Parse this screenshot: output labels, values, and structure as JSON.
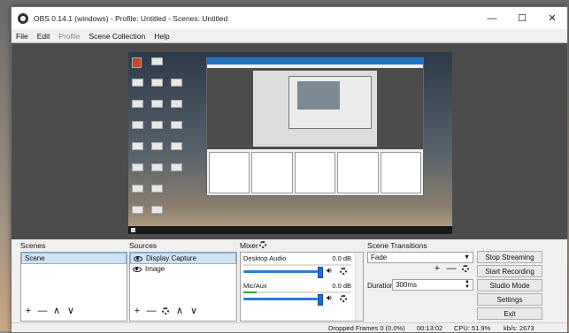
{
  "window": {
    "title": "OBS 0.14.1 (windows) - Profile: Untitled - Scenes: Untitled",
    "minimize_glyph": "—",
    "maximize_glyph": "☐",
    "close_glyph": "✕"
  },
  "menu": [
    "File",
    "Edit",
    "Profile",
    "Scene Collection",
    "Help"
  ],
  "scenes": {
    "label": "Scenes",
    "items": [
      "Scene"
    ],
    "add": "+",
    "remove": "—",
    "up": "∧",
    "down": "∨"
  },
  "sources": {
    "label": "Sources",
    "items": [
      "Display Capture",
      "Image"
    ],
    "add": "+",
    "remove": "—",
    "up": "∧",
    "down": "∨"
  },
  "mixer": {
    "label": "Mixer",
    "channels": [
      {
        "name": "Desktop Audio",
        "db": "0.0 dB",
        "level": 0
      },
      {
        "name": "Mic/Aux",
        "db": "0.0 dB",
        "level": 0.12
      }
    ]
  },
  "transitions": {
    "label": "Scene Transitions",
    "selected": "Fade",
    "add": "+",
    "remove": "—",
    "duration_label": "Duration",
    "duration_value": "300ms"
  },
  "controls": {
    "stop_streaming": "Stop Streaming",
    "start_recording": "Start Recording",
    "studio_mode": "Studio Mode",
    "settings": "Settings",
    "exit": "Exit"
  },
  "status": {
    "dropped": "Dropped Frames 0 (0.0%)",
    "time": "00:13:02",
    "cpu": "CPU: 51.9%",
    "kbps": "kb/s: 2673"
  },
  "colors": {
    "accent": "#1e6fd0",
    "meter_green": "#2fa43a",
    "preview_bg": "#4c4c4c"
  },
  "icons": {
    "eye": "eye-icon",
    "gear": "gear-icon",
    "speaker": "speaker-icon"
  }
}
